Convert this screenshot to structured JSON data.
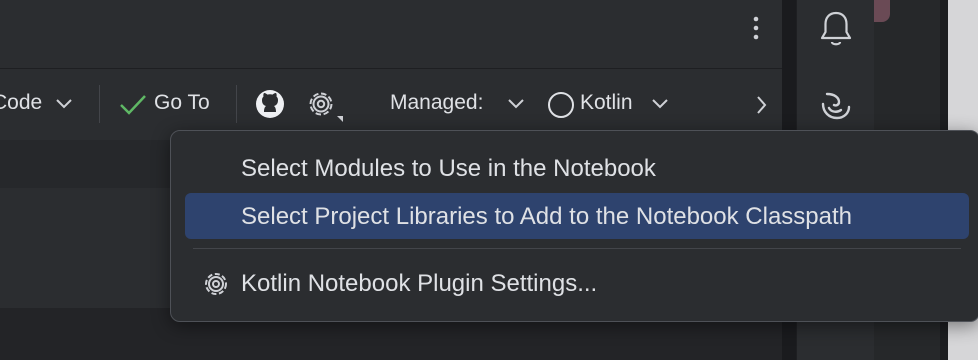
{
  "toolbar": {
    "code_label": "Code",
    "goto_label": "Go To",
    "managed_label": "Managed:",
    "kernel_label": "Kotlin"
  },
  "menu": {
    "items": [
      {
        "label": "Select Modules to Use in the Notebook",
        "selected": false
      },
      {
        "label": "Select Project Libraries to Add to the Notebook Classpath",
        "selected": true
      },
      {
        "label": "Kotlin Notebook Plugin Settings...",
        "selected": false,
        "icon": "gear-icon"
      }
    ]
  },
  "colors": {
    "selection": "#2e436e",
    "success_check": "#5fb865"
  },
  "icons": [
    "more-vertical-icon",
    "bell-icon",
    "ai-assistant-icon",
    "github-icon",
    "gear-icon",
    "circle-status-icon",
    "chevron-down-icon",
    "chevron-right-icon",
    "check-icon"
  ]
}
